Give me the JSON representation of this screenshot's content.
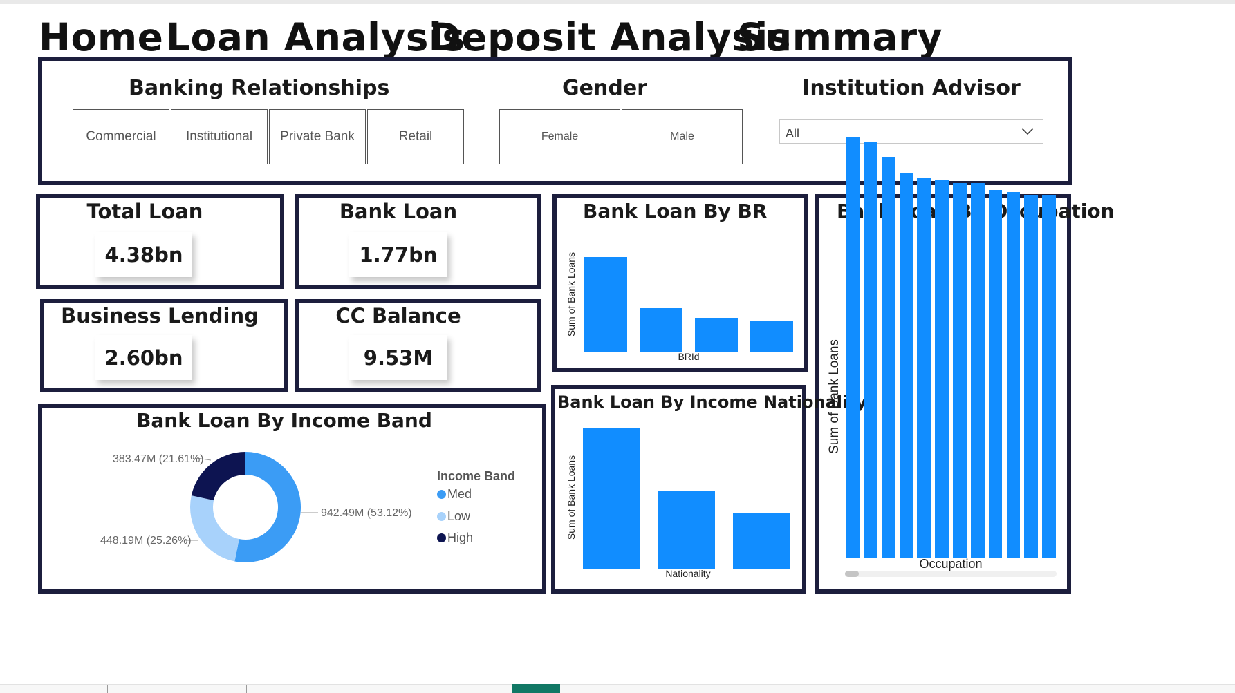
{
  "nav": {
    "home": "Home",
    "loan_analysis": "Loan Analysis",
    "deposit_analysis": "Deposit Analysis",
    "summary": "Summary"
  },
  "filters": {
    "banking_relationships": {
      "title": "Banking Relationships",
      "options": [
        "Commercial",
        "Institutional",
        "Private Bank",
        "Retail"
      ]
    },
    "gender": {
      "title": "Gender",
      "options": [
        "Female",
        "Male"
      ]
    },
    "institution_advisor": {
      "title": "Institution Advisor",
      "selected": "All"
    }
  },
  "kpis": {
    "total_loan": {
      "title": "Total Loan",
      "value": "4.38bn"
    },
    "bank_loan": {
      "title": "Bank Loan",
      "value": "1.77bn"
    },
    "business_lending": {
      "title": "Business Lending",
      "value": "2.60bn"
    },
    "cc_balance": {
      "title": "CC Balance",
      "value": "9.53M"
    }
  },
  "colors": {
    "bar": "#118dff",
    "panel_border": "#1c1e3d",
    "income_med": "#3b9cf5",
    "income_low": "#a8d2fb",
    "income_high": "#0d1451"
  },
  "chart_data": [
    {
      "type": "bar",
      "title": "Bank Loan By BR",
      "xlabel": "BRId",
      "ylabel": "Sum of Bank Loans",
      "values": [
        0.69,
        0.32,
        0.25,
        0.23
      ]
    },
    {
      "type": "bar",
      "title": "Bank Loan By Income Nationality",
      "xlabel": "Nationality",
      "ylabel": "Sum of Bank Loans",
      "values": [
        0.68,
        0.38,
        0.27
      ]
    },
    {
      "type": "bar",
      "title": "Bank Loan By Occupation",
      "xlabel": "Occupation",
      "ylabel": "Sum of Bank Loans",
      "values": [
        0.177,
        0.175,
        0.169,
        0.162,
        0.16,
        0.159,
        0.158,
        0.158,
        0.155,
        0.154,
        0.153,
        0.153
      ]
    },
    {
      "type": "pie",
      "title": "Bank Loan By Income Band",
      "legend_title": "Income Band",
      "legend_position": "right",
      "slices": [
        {
          "name": "Med",
          "value": 942.49,
          "percent": 53.12,
          "label": "942.49M (53.12%)"
        },
        {
          "name": "Low",
          "value": 448.19,
          "percent": 25.26,
          "label": "448.19M (25.26%)"
        },
        {
          "name": "High",
          "value": 383.47,
          "percent": 21.61,
          "label": "383.47M (21.61%)"
        }
      ]
    }
  ]
}
